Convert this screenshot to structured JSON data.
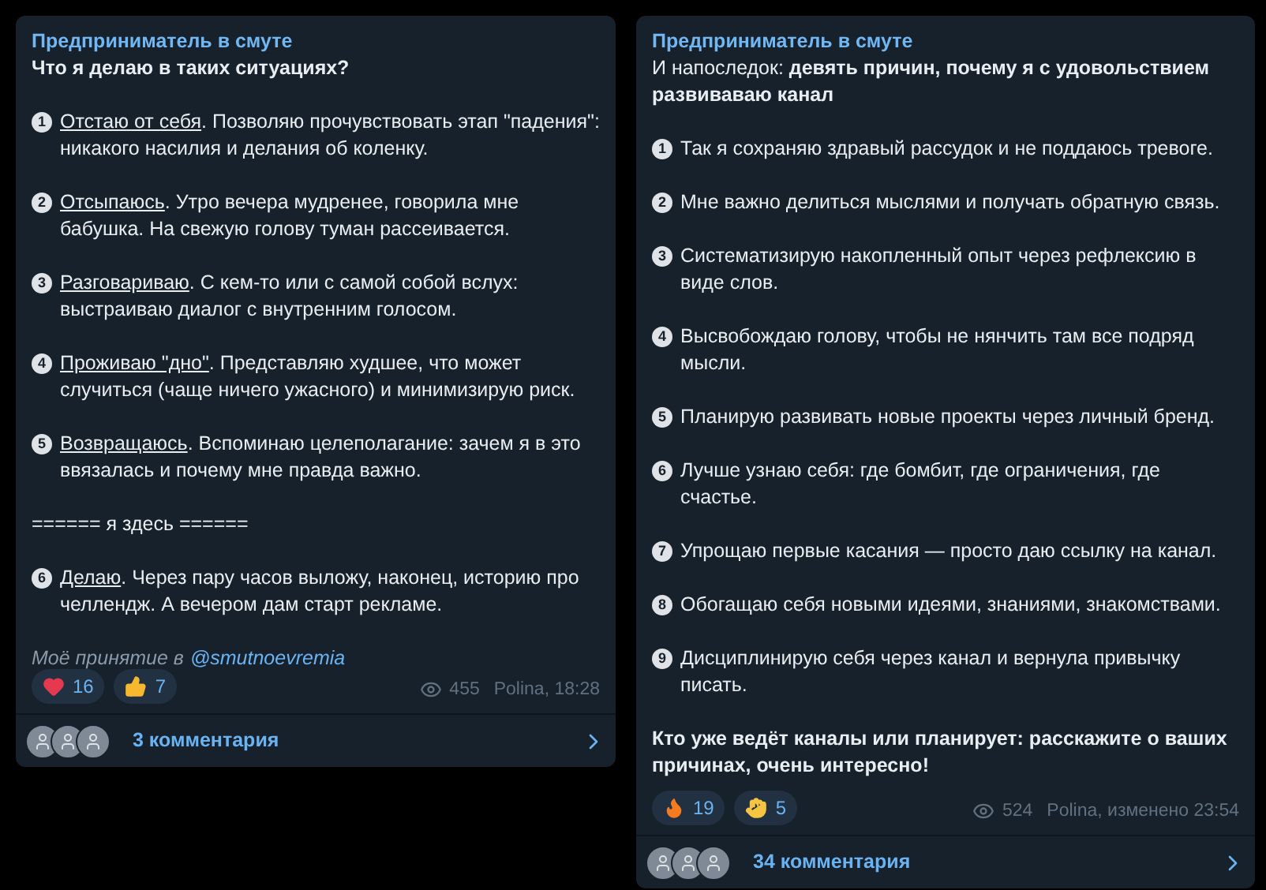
{
  "posts": [
    {
      "channel": "Предприниматель в смуте",
      "blocks": [
        {
          "kind": "heading",
          "text": "Что я делаю в таких ситуациях?"
        },
        {
          "kind": "item",
          "number": "1",
          "lead": "Отстаю от себя",
          "text": ". Позволяю прочувствовать этап \"падения\": никакого насилия и делания об коленку."
        },
        {
          "kind": "item",
          "number": "2",
          "lead": "Отсыпаюсь",
          "text": ". Утро вечера мудренее, говорила мне бабушка. На свежую голову туман рассеивается."
        },
        {
          "kind": "item",
          "number": "3",
          "lead": "Разговариваю",
          "text": ". С кем-то или с самой собой вслух: выстраиваю диалог с внутренним голосом."
        },
        {
          "kind": "item",
          "number": "4",
          "lead": "Проживаю \"дно\"",
          "text": ". Представляю худшее, что может случиться (чаще ничего ужасного) и минимизирую риск."
        },
        {
          "kind": "item",
          "number": "5",
          "lead": "Возвращаюсь",
          "text": ". Вспоминаю целеполагание: зачем я в это ввязалась и почему мне правда важно."
        },
        {
          "kind": "plain",
          "text": "====== я здесь ======"
        },
        {
          "kind": "item",
          "number": "6",
          "lead": "Делаю",
          "text": ". Через пару часов выложу, наконец, историю про челлендж. А вечером дам старт рекламе."
        },
        {
          "kind": "signature",
          "text": "Моё принятие в",
          "link": "@smutnoevremia"
        }
      ],
      "reactions": [
        {
          "kind": "heart",
          "count": "16"
        },
        {
          "kind": "thumbs",
          "count": "7"
        }
      ],
      "views": "455",
      "author_time": "Polina, 18:28",
      "comments": "3 комментария"
    },
    {
      "channel": "Предприниматель в смуте",
      "blocks": [
        {
          "kind": "plain",
          "text": "И напоследок: **девять причин, почему я с удовольствием развиваваю канал**"
        },
        {
          "kind": "item",
          "number": "1",
          "text": "Так я сохраняю здравый рассудок и не поддаюсь тревоге."
        },
        {
          "kind": "item",
          "number": "2",
          "text": "Мне важно делиться мыслями и получать обратную связь."
        },
        {
          "kind": "item",
          "number": "3",
          "text": "Систематизирую накопленный опыт через рефлексию в виде слов."
        },
        {
          "kind": "item",
          "number": "4",
          "text": "Высвобождаю голову, чтобы не нянчить там все подряд мысли."
        },
        {
          "kind": "item",
          "number": "5",
          "text": "Планирую развивать новые проекты через личный бренд."
        },
        {
          "kind": "item",
          "number": "6",
          "text": "Лучше узнаю себя: где бомбит, где ограничения, где счастье."
        },
        {
          "kind": "item",
          "number": "7",
          "text": "Упрощаю первые касания — просто даю ссылку на канал."
        },
        {
          "kind": "item",
          "number": "8",
          "text": "Обогащаю себя новыми идеями, знаниями, знакомствами."
        },
        {
          "kind": "item",
          "number": "9",
          "text": "Дисциплинирую себя через канал и вернула привычку писать."
        },
        {
          "kind": "heading",
          "text": "Кто уже ведёт каналы или планирует: расскажите о ваших причинах, очень интересно!"
        }
      ],
      "reactions": [
        {
          "kind": "fire",
          "count": "19"
        },
        {
          "kind": "clap",
          "count": "5"
        }
      ],
      "views": "524",
      "author_time": "Polina, изменено 23:54",
      "comments": "34 комментария"
    }
  ]
}
